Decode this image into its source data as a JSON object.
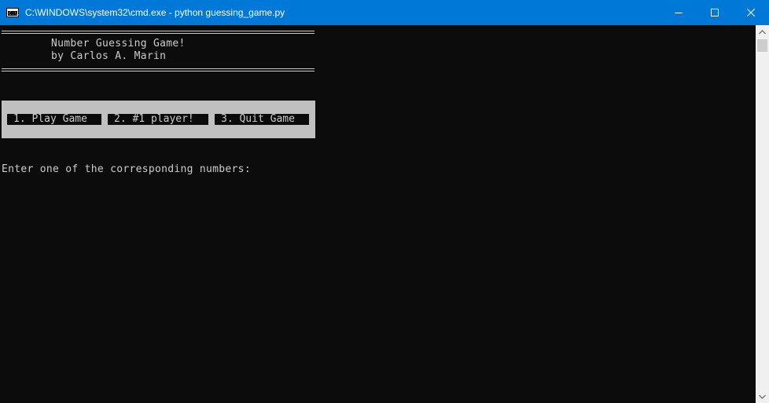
{
  "window": {
    "title": "C:\\WINDOWS\\system32\\cmd.exe - python  guessing_game.py",
    "icon_label": "C:\\."
  },
  "header": {
    "title_line": "Number Guessing Game!",
    "author_line": "by Carlos A. Marin"
  },
  "menu": {
    "options": [
      {
        "label": "1. Play Game"
      },
      {
        "label": "2. #1 player!"
      },
      {
        "label": "3. Quit Game"
      }
    ]
  },
  "prompt": {
    "text": "Enter one of the corresponding numbers:"
  },
  "colors": {
    "titlebar": "#0078d7",
    "console_bg": "#0c0c0c",
    "console_text": "#cccccc",
    "menu_band": "#c0c0c0"
  }
}
